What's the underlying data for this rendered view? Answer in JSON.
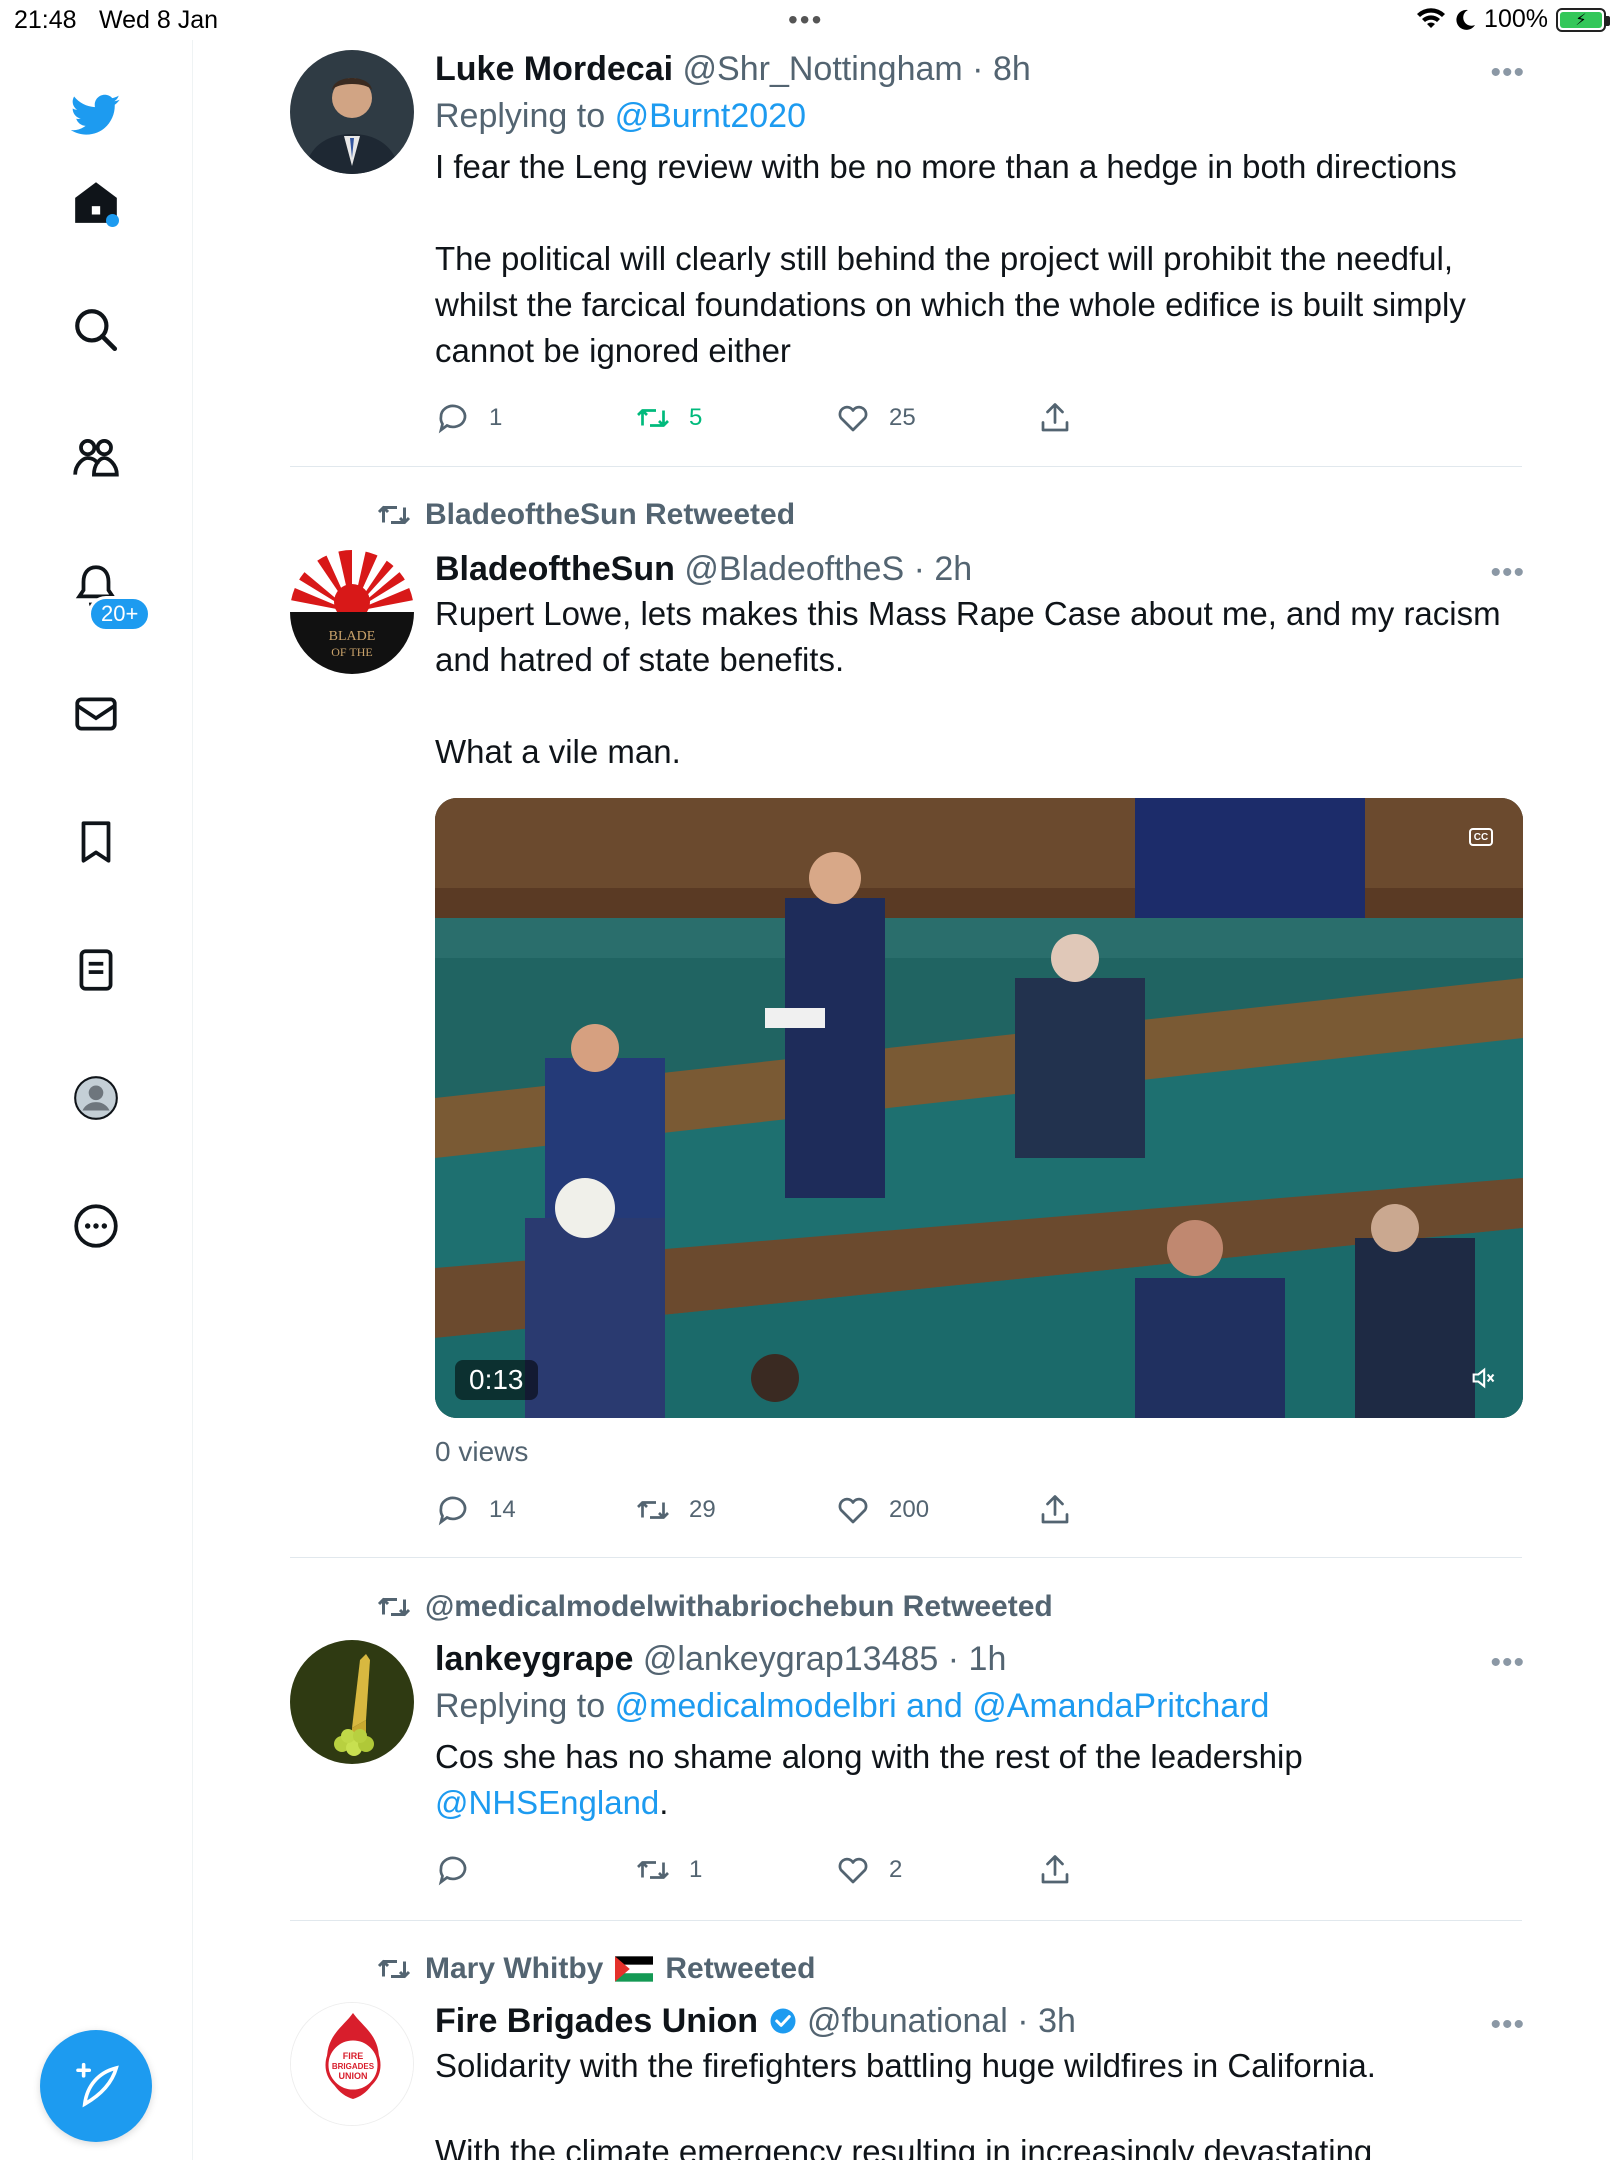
{
  "status_bar": {
    "time": "21:48",
    "date": "Wed 8 Jan",
    "battery": "100%"
  },
  "sidebar": {
    "notifications_badge": "20+"
  },
  "tweets": [
    {
      "name": "Luke Mordecai",
      "handle": "@Shr_Nottingham",
      "time": "8h",
      "replying_label": "Replying to",
      "replying_to": "@Burnt2020",
      "text": "I fear the Leng review with be no more than a hedge in both directions\n\nThe political will clearly still behind the project will prohibit the needful, whilst the farcical foundations on which the whole edifice is built simply cannot be ignored either",
      "replies": "1",
      "retweets": "5",
      "likes": "25"
    },
    {
      "retweeted_by": "BladeoftheSun Retweeted",
      "name": "BladeoftheSun",
      "handle": "@BladeoftheS",
      "time": "2h",
      "text": "Rupert Lowe, lets makes this Mass Rape Case about me, and my racism and hatred of state benefits.\n\nWhat a vile man.",
      "video_time": "0:13",
      "views": "0 views",
      "replies": "14",
      "retweets": "29",
      "likes": "200"
    },
    {
      "retweeted_by": "@medicalmodelwithabriochebun Retweeted",
      "name": "lankeygrape",
      "handle": "@lankeygrap13485",
      "time": "1h",
      "replying_label": "Replying to",
      "replying_to": "@medicalmodelbri and @AmandaPritchard",
      "text": "Cos she has no shame along with the rest of the leadership",
      "text_link": "@NHSEngland",
      "text_suffix": ".",
      "replies": "",
      "retweets": "1",
      "likes": "2"
    },
    {
      "retweeted_by_name": "Mary Whitby",
      "retweeted_by_suffix": "Retweeted",
      "name": "Fire Brigades Union",
      "handle": "@fbunational",
      "time": "3h",
      "text": "Solidarity with the firefighters battling huge wildfires in California.",
      "text_cutoff": "With the climate emergency resulting in increasingly devastating",
      "avatar_text": "FIRE BRIGADES UNION"
    }
  ],
  "colors": {
    "accent": "#1d9bf0",
    "retweet_green": "#00ba7c",
    "muted": "#536471"
  }
}
